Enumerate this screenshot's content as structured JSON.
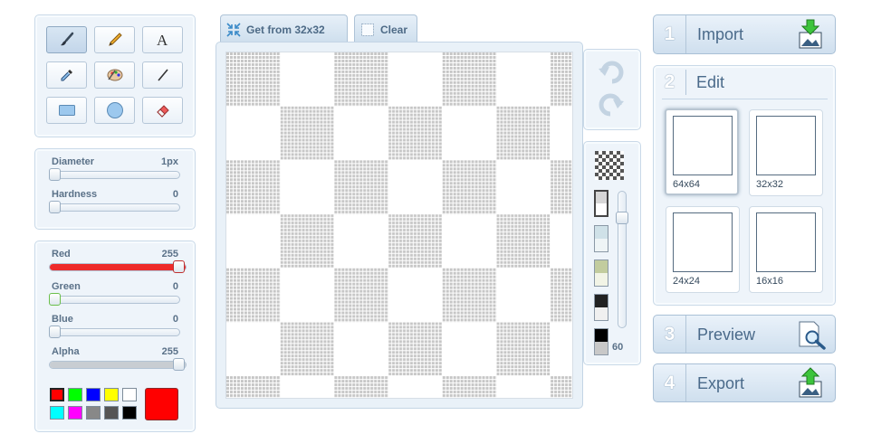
{
  "tabs": {
    "get_from": "Get from 32x32",
    "clear": "Clear"
  },
  "brush": {
    "diameter_label": "Diameter",
    "diameter_value": "1px",
    "hardness_label": "Hardness",
    "hardness_value": "0"
  },
  "color": {
    "red_label": "Red",
    "red_value": "255",
    "green_label": "Green",
    "green_value": "0",
    "blue_label": "Blue",
    "blue_value": "0",
    "alpha_label": "Alpha",
    "alpha_value": "255",
    "current": "#ff0000",
    "palette": [
      "#ff0000",
      "#00ff00",
      "#0000ff",
      "#ffff00",
      "#ffffff",
      "#00ffff",
      "#ff00ff",
      "#888888",
      "#555555",
      "#000000"
    ]
  },
  "background": {
    "opacity_value": "60"
  },
  "steps": {
    "import_num": "1",
    "import_label": "Import",
    "edit_num": "2",
    "edit_label": "Edit",
    "preview_num": "3",
    "preview_label": "Preview",
    "export_num": "4",
    "export_label": "Export"
  },
  "presets": {
    "p64": "64x64",
    "p32": "32x32",
    "p24": "24x24",
    "p16": "16x16"
  }
}
